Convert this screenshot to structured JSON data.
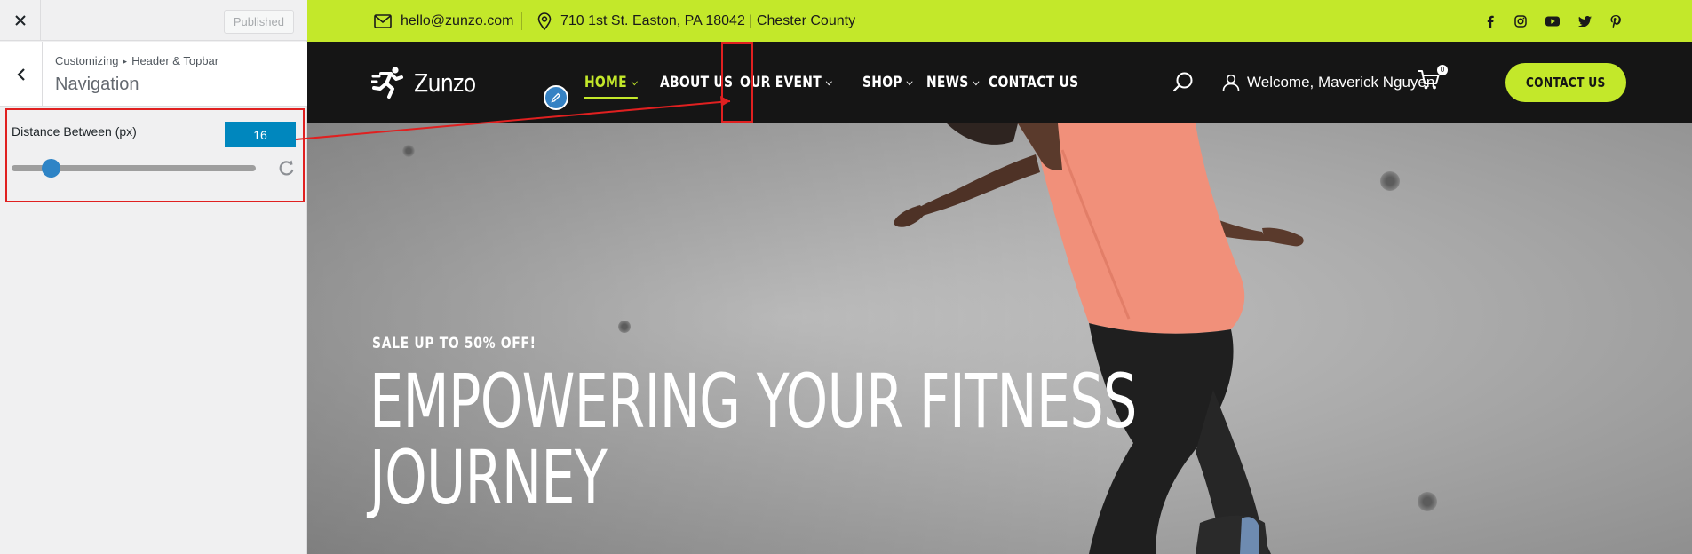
{
  "customizer": {
    "published_label": "Published",
    "breadcrumb_root": "Customizing",
    "breadcrumb_section": "Header & Topbar",
    "section_title": "Navigation",
    "control": {
      "label": "Distance Between (px)",
      "value": "16",
      "slider_fraction": 0.16
    }
  },
  "topbar": {
    "email": "hello@zunzo.com",
    "address": "710 1st St. Easton, PA 18042 | Chester County",
    "social_icons": [
      "facebook-icon",
      "instagram-icon",
      "youtube-icon",
      "twitter-icon",
      "pinterest-icon"
    ],
    "bg_color": "#c3e82a"
  },
  "header": {
    "logo_text": "Zunzo",
    "nav": [
      {
        "label": "HOME",
        "has_dropdown": true,
        "active": true
      },
      {
        "label": "ABOUT US",
        "has_dropdown": false,
        "active": false
      },
      {
        "label": "OUR EVENT",
        "has_dropdown": true,
        "active": false
      },
      {
        "label": "SHOP",
        "has_dropdown": true,
        "active": false
      },
      {
        "label": "NEWS",
        "has_dropdown": true,
        "active": false
      },
      {
        "label": "CONTACT US",
        "has_dropdown": false,
        "active": false
      }
    ],
    "welcome": "Welcome, Maverick Nguyen",
    "cart_count": "0",
    "cta_label": "CONTACT US",
    "accent_color": "#c3e82a"
  },
  "hero": {
    "kicker": "SALE UP TO 50% OFF!",
    "title_line1": "EMPOWERING YOUR FITNESS",
    "title_line2": "JOURNEY"
  },
  "annotation_color": "#e02020"
}
